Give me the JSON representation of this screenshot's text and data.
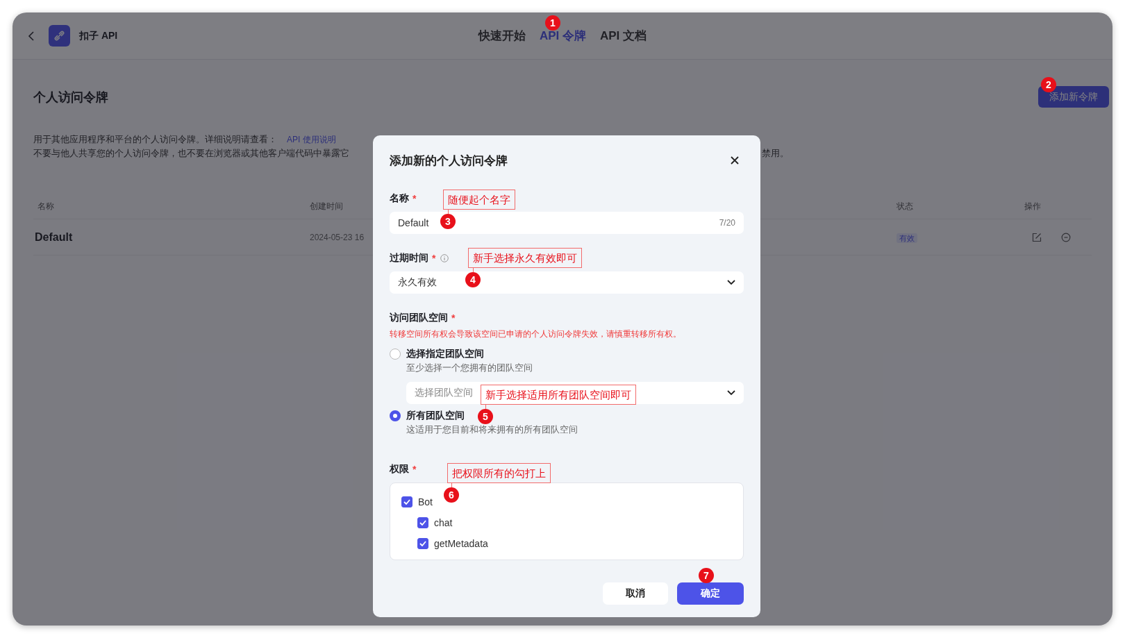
{
  "app": {
    "name": "扣子 API"
  },
  "nav": [
    {
      "label": "快速开始",
      "selected": false
    },
    {
      "label": "API 令牌",
      "selected": true
    },
    {
      "label": "API 文档",
      "selected": false
    }
  ],
  "page": {
    "title": "个人访问令牌",
    "add_button": "添加新令牌",
    "description": {
      "line_1": "用于其他应用程序和平台的个人访问令牌。详细说明请查看：",
      "link": "API 使用说明",
      "line_2_start": "不要与他人共享您的个人访问令牌，也不要在浏览器或其他客户端代码中暴露它",
      "line_2_end": "禁用。"
    }
  },
  "table": {
    "columns": [
      "名称",
      "创建时间",
      "状态",
      "操作"
    ],
    "rows": [
      {
        "name": "Default",
        "created": "2024-05-23 16",
        "status": "有效"
      }
    ]
  },
  "dialog": {
    "title": "添加新的个人访问令牌",
    "name_field": {
      "label": "名称",
      "mark": "*",
      "value": "Default",
      "counter": "7/20"
    },
    "expiry_field": {
      "label": "过期时间",
      "mark": "*",
      "value": "永久有效"
    },
    "team_space": {
      "label": "访问团队空间",
      "mark": "*",
      "warning": "转移空间所有权会导致该空间已申请的个人访问令牌失效，请慎重转移所有权。",
      "options": [
        {
          "label": "选择指定团队空间",
          "hint": "至少选择一个您拥有的团队空间",
          "selected": false,
          "placeholder": "选择团队空间"
        },
        {
          "label": "所有团队空间",
          "hint": "这适用于您目前和将来拥有的所有团队空间",
          "selected": true
        }
      ]
    },
    "permissions": {
      "label": "权限",
      "mark": "*",
      "items": [
        {
          "label": "Bot",
          "checked": true,
          "children": [
            {
              "label": "chat",
              "checked": true
            },
            {
              "label": "getMetadata",
              "checked": true
            }
          ]
        }
      ]
    },
    "buttons": [
      {
        "label": "取消",
        "kind": "secondary"
      },
      {
        "label": "确定",
        "kind": "primary"
      }
    ]
  },
  "annotations": [
    {
      "number": "1"
    },
    {
      "number": "2"
    },
    {
      "number": "3",
      "note": "随便起个名字"
    },
    {
      "number": "4",
      "note": "新手选择永久有效即可"
    },
    {
      "number": "5",
      "note": "新手选择适用所有团队空间即可"
    },
    {
      "number": "6",
      "note": "把权限所有的勾打上"
    },
    {
      "number": "7"
    }
  ]
}
